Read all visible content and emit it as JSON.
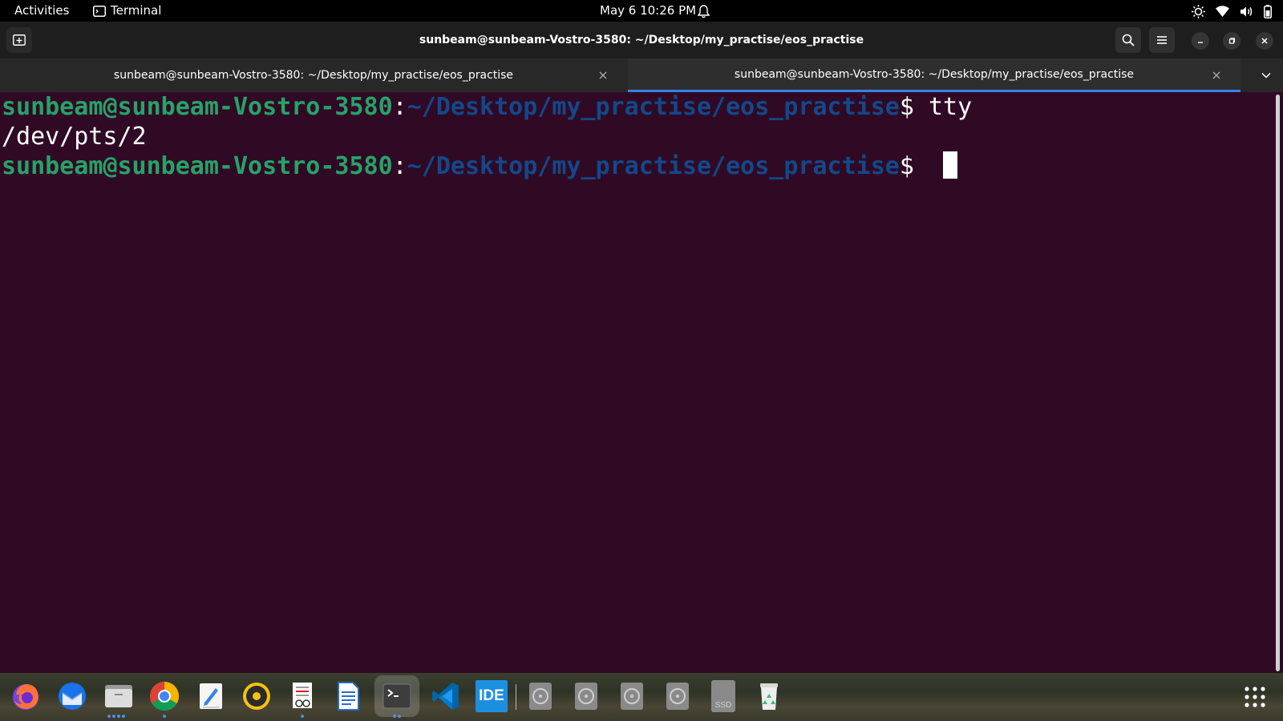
{
  "topbar": {
    "activities": "Activities",
    "app_name": "Terminal",
    "clock": "May 6  10:26 PM"
  },
  "window": {
    "title": "sunbeam@sunbeam-Vostro-3580: ~/Desktop/my_practise/eos_practise"
  },
  "tabs": [
    {
      "label": "sunbeam@sunbeam-Vostro-3580: ~/Desktop/my_practise/eos_practise",
      "active": false
    },
    {
      "label": "sunbeam@sunbeam-Vostro-3580: ~/Desktop/my_practise/eos_practise",
      "active": true
    }
  ],
  "terminal": {
    "line1": {
      "user": "sunbeam@sunbeam-Vostro-3580",
      "sep": ":",
      "path": "~/Desktop/my_practise/eos_practise",
      "prompt": "$ ",
      "command": "tty"
    },
    "line2": {
      "output": "/dev/pts/2"
    },
    "line3": {
      "user": "sunbeam@sunbeam-Vostro-3580",
      "sep": ":",
      "path": "~/Desktop/my_practise/eos_practise",
      "prompt": "$ "
    }
  },
  "dock": {
    "items": [
      "firefox-icon",
      "thunderbird-icon",
      "files-icon",
      "chrome-icon",
      "text-editor-icon",
      "rhythmbox-icon",
      "document-viewer-icon",
      "libreoffice-writer-icon",
      "terminal-icon",
      "vscode-icon",
      "ide-icon",
      "drive-icon",
      "drive-icon",
      "drive-icon",
      "drive-icon",
      "ssd-icon",
      "trash-icon"
    ],
    "ide_label": "IDE",
    "ssd_label": "SSD"
  },
  "colors": {
    "terminal_bg": "#300a24",
    "user_green": "#26a269",
    "path_blue": "#12488b",
    "tab_accent": "#3584e4"
  }
}
